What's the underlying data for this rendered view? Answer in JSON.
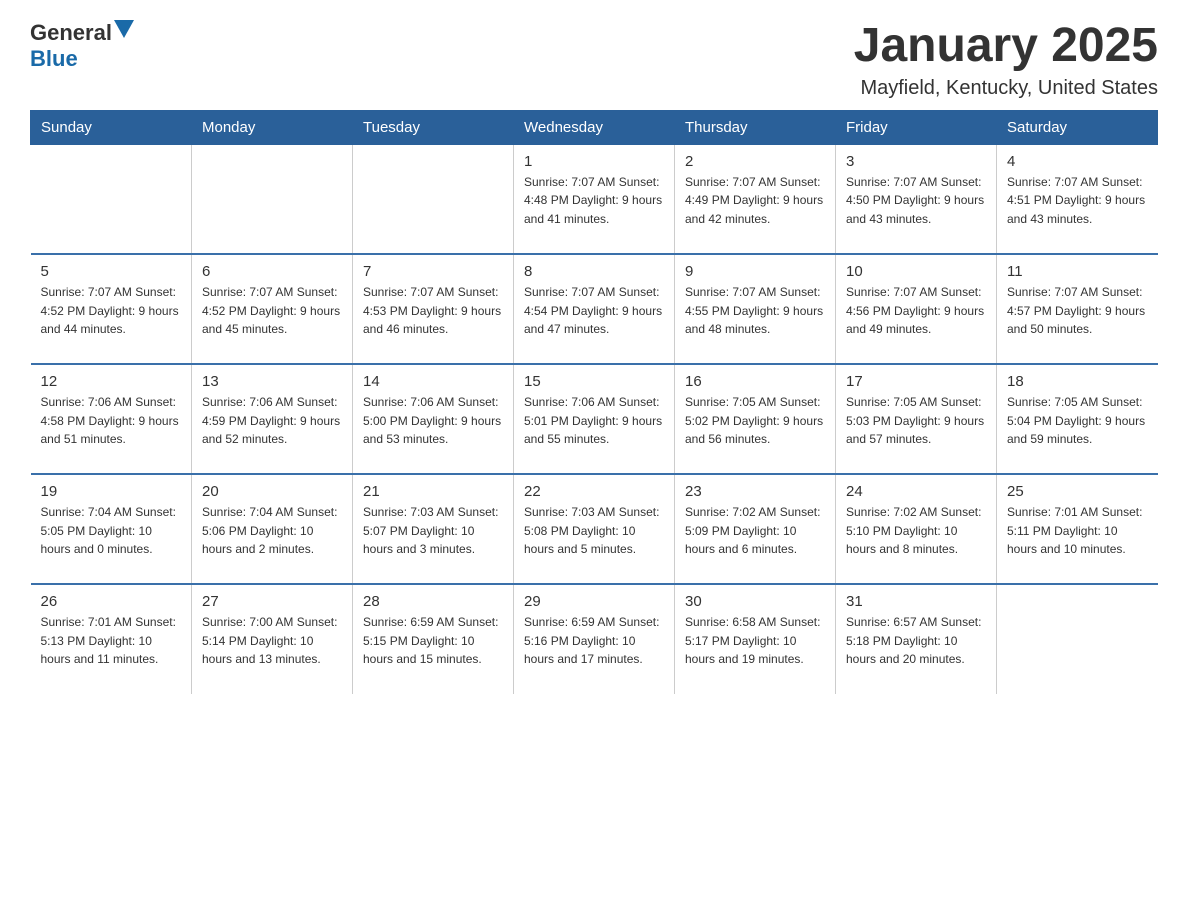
{
  "header": {
    "logo_general": "General",
    "logo_blue": "Blue",
    "title": "January 2025",
    "subtitle": "Mayfield, Kentucky, United States"
  },
  "days_of_week": [
    "Sunday",
    "Monday",
    "Tuesday",
    "Wednesday",
    "Thursday",
    "Friday",
    "Saturday"
  ],
  "weeks": [
    [
      {
        "day": "",
        "info": ""
      },
      {
        "day": "",
        "info": ""
      },
      {
        "day": "",
        "info": ""
      },
      {
        "day": "1",
        "info": "Sunrise: 7:07 AM\nSunset: 4:48 PM\nDaylight: 9 hours\nand 41 minutes."
      },
      {
        "day": "2",
        "info": "Sunrise: 7:07 AM\nSunset: 4:49 PM\nDaylight: 9 hours\nand 42 minutes."
      },
      {
        "day": "3",
        "info": "Sunrise: 7:07 AM\nSunset: 4:50 PM\nDaylight: 9 hours\nand 43 minutes."
      },
      {
        "day": "4",
        "info": "Sunrise: 7:07 AM\nSunset: 4:51 PM\nDaylight: 9 hours\nand 43 minutes."
      }
    ],
    [
      {
        "day": "5",
        "info": "Sunrise: 7:07 AM\nSunset: 4:52 PM\nDaylight: 9 hours\nand 44 minutes."
      },
      {
        "day": "6",
        "info": "Sunrise: 7:07 AM\nSunset: 4:52 PM\nDaylight: 9 hours\nand 45 minutes."
      },
      {
        "day": "7",
        "info": "Sunrise: 7:07 AM\nSunset: 4:53 PM\nDaylight: 9 hours\nand 46 minutes."
      },
      {
        "day": "8",
        "info": "Sunrise: 7:07 AM\nSunset: 4:54 PM\nDaylight: 9 hours\nand 47 minutes."
      },
      {
        "day": "9",
        "info": "Sunrise: 7:07 AM\nSunset: 4:55 PM\nDaylight: 9 hours\nand 48 minutes."
      },
      {
        "day": "10",
        "info": "Sunrise: 7:07 AM\nSunset: 4:56 PM\nDaylight: 9 hours\nand 49 minutes."
      },
      {
        "day": "11",
        "info": "Sunrise: 7:07 AM\nSunset: 4:57 PM\nDaylight: 9 hours\nand 50 minutes."
      }
    ],
    [
      {
        "day": "12",
        "info": "Sunrise: 7:06 AM\nSunset: 4:58 PM\nDaylight: 9 hours\nand 51 minutes."
      },
      {
        "day": "13",
        "info": "Sunrise: 7:06 AM\nSunset: 4:59 PM\nDaylight: 9 hours\nand 52 minutes."
      },
      {
        "day": "14",
        "info": "Sunrise: 7:06 AM\nSunset: 5:00 PM\nDaylight: 9 hours\nand 53 minutes."
      },
      {
        "day": "15",
        "info": "Sunrise: 7:06 AM\nSunset: 5:01 PM\nDaylight: 9 hours\nand 55 minutes."
      },
      {
        "day": "16",
        "info": "Sunrise: 7:05 AM\nSunset: 5:02 PM\nDaylight: 9 hours\nand 56 minutes."
      },
      {
        "day": "17",
        "info": "Sunrise: 7:05 AM\nSunset: 5:03 PM\nDaylight: 9 hours\nand 57 minutes."
      },
      {
        "day": "18",
        "info": "Sunrise: 7:05 AM\nSunset: 5:04 PM\nDaylight: 9 hours\nand 59 minutes."
      }
    ],
    [
      {
        "day": "19",
        "info": "Sunrise: 7:04 AM\nSunset: 5:05 PM\nDaylight: 10 hours\nand 0 minutes."
      },
      {
        "day": "20",
        "info": "Sunrise: 7:04 AM\nSunset: 5:06 PM\nDaylight: 10 hours\nand 2 minutes."
      },
      {
        "day": "21",
        "info": "Sunrise: 7:03 AM\nSunset: 5:07 PM\nDaylight: 10 hours\nand 3 minutes."
      },
      {
        "day": "22",
        "info": "Sunrise: 7:03 AM\nSunset: 5:08 PM\nDaylight: 10 hours\nand 5 minutes."
      },
      {
        "day": "23",
        "info": "Sunrise: 7:02 AM\nSunset: 5:09 PM\nDaylight: 10 hours\nand 6 minutes."
      },
      {
        "day": "24",
        "info": "Sunrise: 7:02 AM\nSunset: 5:10 PM\nDaylight: 10 hours\nand 8 minutes."
      },
      {
        "day": "25",
        "info": "Sunrise: 7:01 AM\nSunset: 5:11 PM\nDaylight: 10 hours\nand 10 minutes."
      }
    ],
    [
      {
        "day": "26",
        "info": "Sunrise: 7:01 AM\nSunset: 5:13 PM\nDaylight: 10 hours\nand 11 minutes."
      },
      {
        "day": "27",
        "info": "Sunrise: 7:00 AM\nSunset: 5:14 PM\nDaylight: 10 hours\nand 13 minutes."
      },
      {
        "day": "28",
        "info": "Sunrise: 6:59 AM\nSunset: 5:15 PM\nDaylight: 10 hours\nand 15 minutes."
      },
      {
        "day": "29",
        "info": "Sunrise: 6:59 AM\nSunset: 5:16 PM\nDaylight: 10 hours\nand 17 minutes."
      },
      {
        "day": "30",
        "info": "Sunrise: 6:58 AM\nSunset: 5:17 PM\nDaylight: 10 hours\nand 19 minutes."
      },
      {
        "day": "31",
        "info": "Sunrise: 6:57 AM\nSunset: 5:18 PM\nDaylight: 10 hours\nand 20 minutes."
      },
      {
        "day": "",
        "info": ""
      }
    ]
  ]
}
